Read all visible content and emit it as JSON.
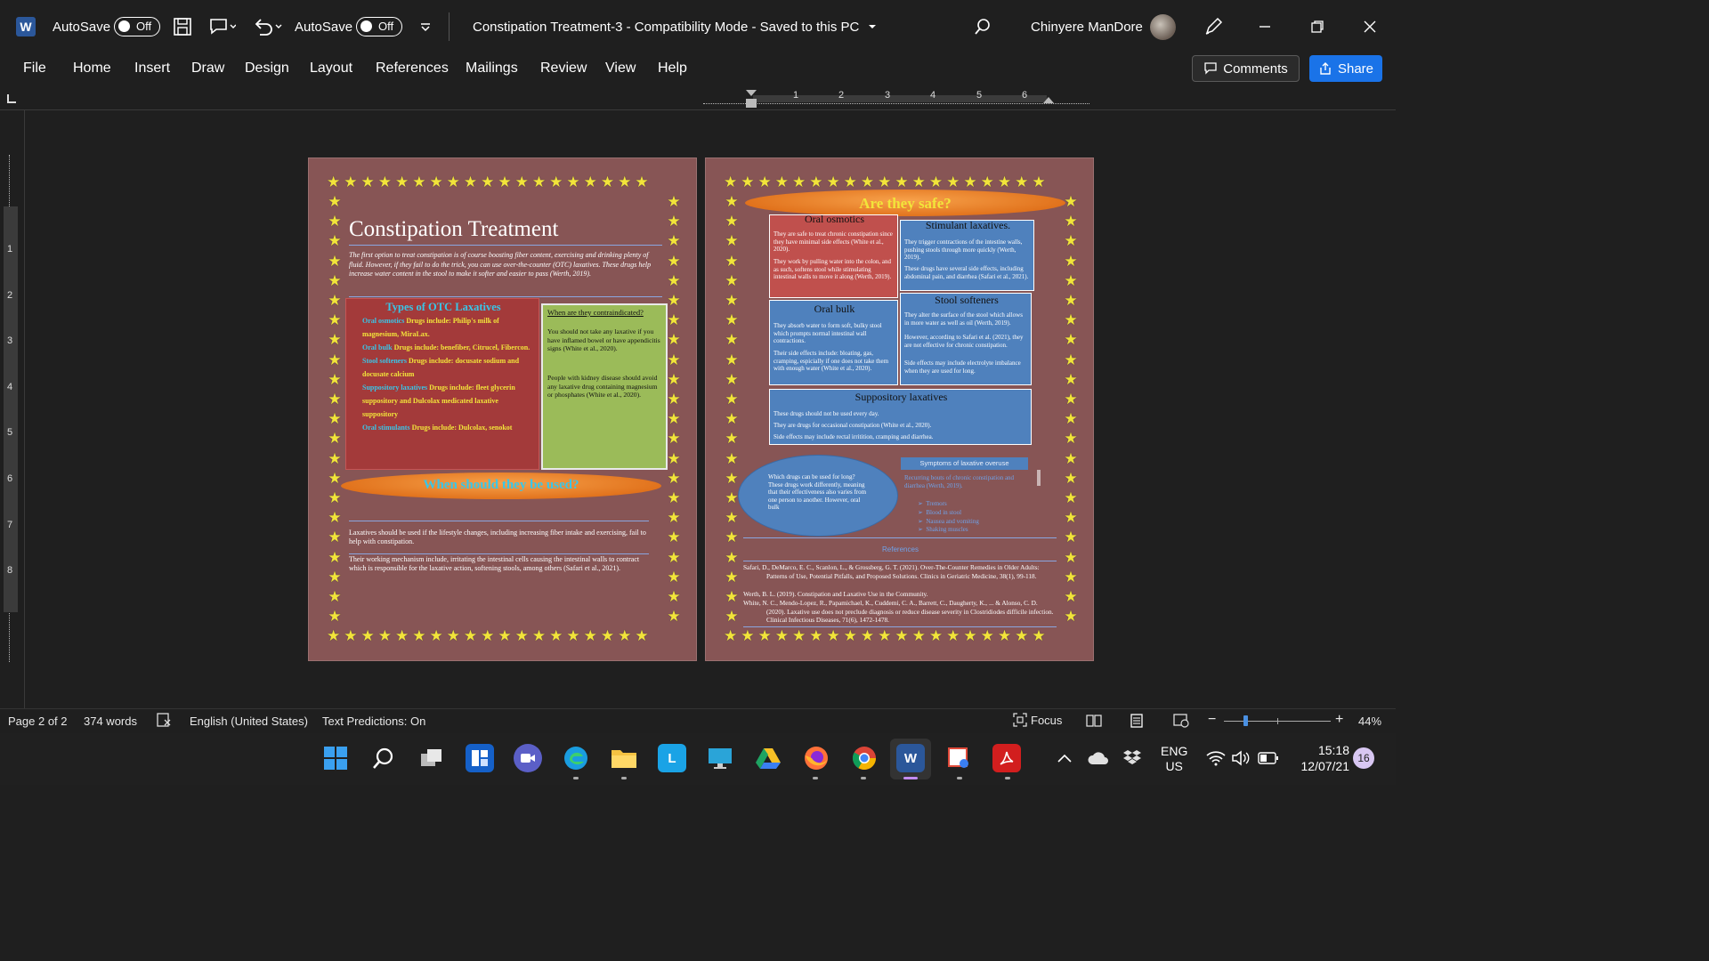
{
  "titlebar": {
    "autosave_label_1": "AutoSave",
    "autosave_state_1": "Off",
    "autosave_label_2": "AutoSave",
    "autosave_state_2": "Off",
    "doc_title": "Constipation Treatment-3  -  Compatibility Mode  -  Saved to this PC",
    "user_name": "Chinyere ManDore"
  },
  "ribbon": {
    "tabs": [
      "File",
      "Home",
      "Insert",
      "Draw",
      "Design",
      "Layout",
      "References",
      "Mailings",
      "Review",
      "View",
      "Help"
    ],
    "comments_label": "Comments",
    "share_label": "Share"
  },
  "ruler": {
    "numbers": [
      "1",
      "2",
      "3",
      "4",
      "5",
      "6"
    ],
    "v_numbers": [
      "1",
      "2",
      "3",
      "4",
      "5",
      "6",
      "7",
      "8"
    ]
  },
  "page1": {
    "title": "Constipation Treatment",
    "intro": "The first option to treat constipation is of course boosting fiber content, exercising and drinking plenty of fluid. However, if they fail to do the trick, you can use over-the-counter (OTC) laxatives. These drugs help increase water content in the stool to make it softer and easier to pass (Werth, 2019).",
    "types_heading": "Types of OTC Laxatives",
    "types": [
      {
        "name": "Oral osmotics",
        "text": "Drugs include: Philip's milk of magnesium, MiraLax."
      },
      {
        "name": "Oral bulk",
        "text": "Drugs include: benefiber, Citrucel, Fibercon."
      },
      {
        "name": "Stool softeners",
        "text": "Drugs include: docusate sodium and docusate calcium"
      },
      {
        "name": "Suppository laxatives",
        "text": "Drugs include: fleet glycerin suppository and Dulcolax medicated laxative suppository"
      },
      {
        "name": "Oral stimulants",
        "text": "Drugs include: Dulcolax, senokot"
      }
    ],
    "contra_heading": "When are they contraindicated?",
    "contra_p1": "You should not take any laxative if you have inflamed bowel or have appendicitis signs (White et al., 2020).",
    "contra_p2": "People with kidney disease should avoid any laxative drug containing magnesium or phosphates (White et al., 2020).",
    "when_heading": "When should they be used?",
    "when_p1": "Laxatives should be used if the lifestyle changes, including increasing fiber intake and exercising, fail to help with constipation.",
    "when_p2": "Their working mechanism include, irritating the intestinal cells causing the intestinal walls to contract which is responsible for the laxative action, softening stools, among others (Safari et al., 2021)."
  },
  "page2": {
    "safe_heading": "Are they safe?",
    "osmotics_title": "Oral osmotics",
    "osmotics_p1": "They are safe to treat chronic constipation since they have minimal side effects (White et al., 2020).",
    "osmotics_p2": "They work by pulling water into the colon, and as such, softens stool while stimulating intestinal walls to move it along (Werth, 2019).",
    "stimulant_title": "Stimulant laxatives.",
    "stimulant_p1": "They trigger contractions of the intestine walls, pushing stools through more quickly (Werth, 2019).",
    "stimulant_p2": "These drugs have several side effects, including abdominal pain, and diarrhea (Safari et al., 2021).",
    "bulk_title": "Oral bulk",
    "bulk_p1": "They absorb water to form soft, bulky stool which prompts normal intestinal wall contractions.",
    "bulk_p2": "Their side effects include: bloating, gas, cramping, espicially if one does not take them with enough water (White et al., 2020).",
    "softeners_title": "Stool softeners",
    "softeners_p1": "They alter the surface of the stool which allows in more water as well as oil (Werth, 2019).",
    "softeners_p2": "However, according to Safari et al. (2021), they are not effective for chronic constipation.",
    "softeners_p3": "Side effects may include electrolyte imbalance when they are used for long.",
    "supp_title": "Suppository laxatives",
    "supp_p1": "These drugs should not be used every day.",
    "supp_p2": "They are drugs for occasional constipation (White et al., 2020).",
    "supp_p3": "Side effects may include rectal irritition, cramping and diarrhea.",
    "oval_text": "Which drugs can be used for long? These drugs work differently, meaning that their effectiveness also varies from one person to another. However, oral bulk",
    "overuse_title": "Symptoms of laxative overuse",
    "overuse_intro": "Recurring bouts of chronic constipation and diarrhea (Werth, 2019).",
    "overuse_items": [
      "Tremors",
      "Blood in stool",
      "Nausea and vomiting",
      "Shaking muscles"
    ],
    "references_heading": "References",
    "ref1": "Safari, D., DeMarco, E. C., Scanlon, L., & Grossberg, G. T. (2021). Over-The-Counter Remedies in Older Adults: Patterns of Use, Potential Pitfalls, and Proposed Solutions. Clinics in Geriatric Medicine, 38(1), 99-118.",
    "ref2": "Werth, B. L. (2019). Constipation and Laxative Use in the Community.",
    "ref3": "White, N. C., Mendo-Lopez, R., Papamichael, K., Cuddemi, C. A., Barrett, C., Daugherty, K., ... & Alonso, C. D. (2020). Laxative use does not preclude diagnosis or reduce disease severity in Clostridiodes difficile infection. Clinical Infectious Diseases, 71(6), 1472-1478."
  },
  "status": {
    "page": "Page 2 of 2",
    "words": "374 words",
    "language": "English (United States)",
    "predictions": "Text Predictions: On",
    "focus": "Focus",
    "zoom": "44%"
  },
  "taskbar": {
    "lang1": "ENG",
    "lang2": "US",
    "time": "15:18",
    "date": "12/07/21",
    "badge": "16"
  },
  "colors": {
    "page_bg": "#875555",
    "accent_blue": "#1a73e8",
    "star": "#f2e43a",
    "orange": "#f08a1c"
  }
}
